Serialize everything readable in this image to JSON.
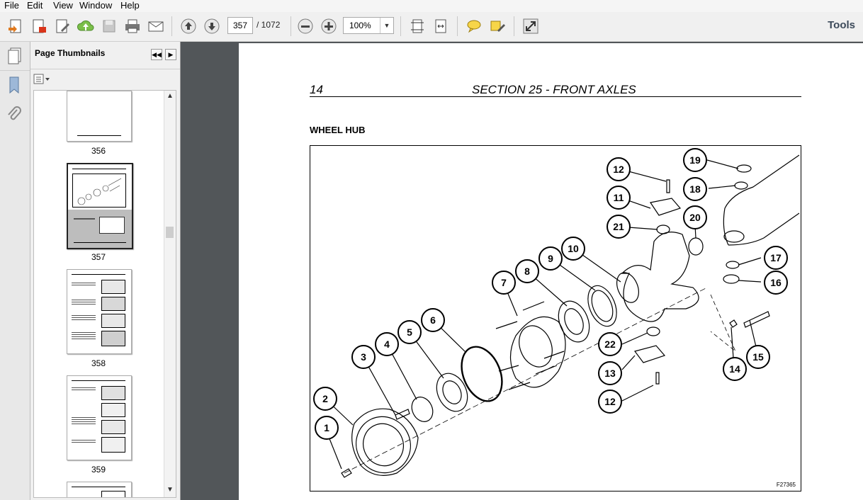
{
  "menu": [
    "File",
    "Edit",
    "View",
    "Window",
    "Help"
  ],
  "toolbar": {
    "page_current": "357",
    "page_total": "/ 1072",
    "zoom": "100%",
    "tools_label": "Tools",
    "icons": [
      "create-icon",
      "edit-pdf-icon",
      "edit-icon",
      "upload-cloud-icon",
      "save-icon",
      "print-icon",
      "email-icon",
      "prev-page-icon",
      "next-page-icon",
      "zoom-out-icon",
      "zoom-in-icon",
      "fit-page-icon",
      "fit-width-icon",
      "comment-icon",
      "highlight-icon",
      "fullscreen-icon"
    ]
  },
  "thumbnails": {
    "title": "Page Thumbnails",
    "pages": [
      "356",
      "357",
      "358",
      "359"
    ]
  },
  "document": {
    "page_number": "14",
    "section_title": "SECTION 25 - FRONT AXLES",
    "heading": "WHEEL HUB",
    "figure_code": "F27365",
    "callouts": [
      "1",
      "2",
      "3",
      "4",
      "5",
      "6",
      "7",
      "8",
      "9",
      "10",
      "11",
      "12",
      "12",
      "13",
      "14",
      "15",
      "16",
      "17",
      "18",
      "19",
      "20",
      "21",
      "22"
    ]
  }
}
